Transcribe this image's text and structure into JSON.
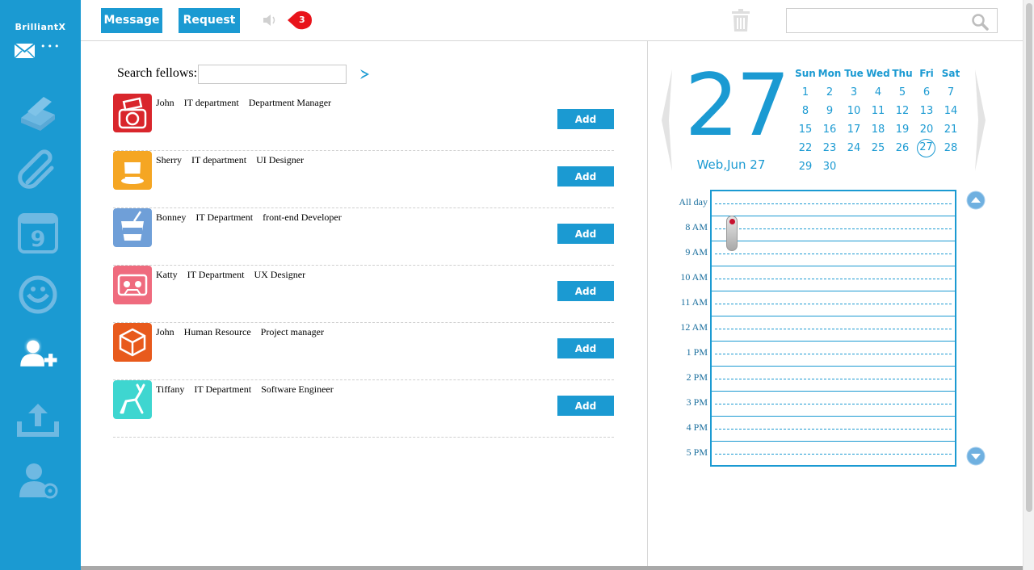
{
  "sidebar": {
    "brand": "BrilliantX",
    "brand_dots": "•••",
    "nav": [
      "compose-icon",
      "attachment-icon",
      "calendar-icon",
      "emoticon-icon",
      "add-user-icon",
      "upload-icon",
      "user-settings-icon"
    ],
    "active": "add-user-icon",
    "calendar_icon_day": "9"
  },
  "header": {
    "message_label": "Message",
    "request_label": "Request",
    "notification_count": "3",
    "search_placeholder": ""
  },
  "fellows": {
    "search_label": "Search fellows:",
    "search_value": "",
    "add_label": "Add",
    "list": [
      {
        "name": "John",
        "department": "IT department",
        "role": "Department Manager",
        "avatar": "camera-icon",
        "color": "#d9262c"
      },
      {
        "name": "Sherry",
        "department": "IT department",
        "role": "UI Designer",
        "avatar": "hat-icon",
        "color": "#f5a623"
      },
      {
        "name": "Bonney",
        "department": "IT Department",
        "role": "front-end Developer",
        "avatar": "yum-cup-icon",
        "color": "#6f9fd8"
      },
      {
        "name": "Katty",
        "department": "IT Department",
        "role": "UX Designer",
        "avatar": "cassette-icon",
        "color": "#ef6b7e"
      },
      {
        "name": "John",
        "department": "Human Resource",
        "role": "Project manager",
        "avatar": "cube-icon",
        "color": "#e85a1c"
      },
      {
        "name": "Tiffany",
        "department": "IT Department",
        "role": "Software Engineer",
        "avatar": "deer-icon",
        "color": "#3ed6d0"
      }
    ]
  },
  "calendar": {
    "big_day": "27",
    "date_label": "Web,Jun 27",
    "weekdays": [
      "Sun",
      "Mon",
      "Tue",
      "Wed",
      "Thu",
      "Fri",
      "Sat"
    ],
    "days": [
      "1",
      "2",
      "3",
      "4",
      "5",
      "6",
      "7",
      "8",
      "9",
      "10",
      "11",
      "12",
      "13",
      "14",
      "15",
      "16",
      "17",
      "18",
      "19",
      "20",
      "21",
      "22",
      "23",
      "24",
      "25",
      "26",
      "27",
      "28",
      "29",
      "30"
    ],
    "first_weekday": 0,
    "selected": "27"
  },
  "schedule": {
    "times": [
      "All day",
      "8 AM",
      "9 AM",
      "10 AM",
      "11 AM",
      "12 AM",
      "1 PM",
      "2 PM",
      "3 PM",
      "4 PM",
      "5 PM"
    ]
  },
  "colors": {
    "accent": "#1b9ad2",
    "badge": "#e8141b"
  }
}
